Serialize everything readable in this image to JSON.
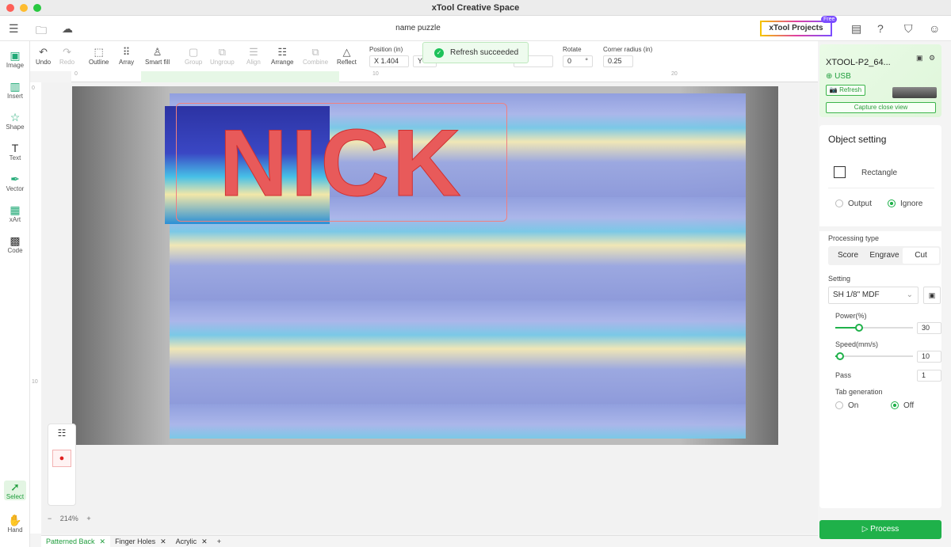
{
  "app_title": "xTool Creative Space",
  "document_name": "name puzzle",
  "header": {
    "projects_label": "xTool Projects",
    "free_badge": "Free"
  },
  "left_tools": [
    {
      "label": "Image"
    },
    {
      "label": "Insert"
    },
    {
      "label": "Shape"
    },
    {
      "label": "Text"
    },
    {
      "label": "Vector"
    },
    {
      "label": "xArt"
    },
    {
      "label": "Code"
    },
    {
      "label": "Select"
    },
    {
      "label": "Hand"
    }
  ],
  "toolbar": {
    "undo": "Undo",
    "redo": "Redo",
    "outline": "Outline",
    "array": "Array",
    "smart_fill": "Smart fill",
    "group": "Group",
    "ungroup": "Ungroup",
    "align": "Align",
    "arrange": "Arrange",
    "combine": "Combine",
    "reflect": "Reflect",
    "position_label": "Position (in)",
    "x_value": "X 1.404",
    "y_value": "Y",
    "rotate_label": "Rotate",
    "rotate_value": "0",
    "rotate_unit": "°",
    "corner_label": "Corner radius (in)",
    "corner_value": "0.25"
  },
  "toast": "Refresh succeeded",
  "ruler": {
    "h_ticks": [
      "0",
      "10",
      "20"
    ],
    "v_ticks": [
      "0",
      "10"
    ]
  },
  "canvas": {
    "text": "NICK"
  },
  "zoom": {
    "value": "214%",
    "minus": "−",
    "plus": "+"
  },
  "tabs": [
    {
      "label": "Patterned Back",
      "active": true
    },
    {
      "label": "Finger Holes"
    },
    {
      "label": "Acrylic"
    }
  ],
  "device": {
    "name": "XTOOL-P2_64...",
    "connection": "USB",
    "refresh": "Refresh",
    "capture": "Capture close view"
  },
  "object_setting": {
    "title": "Object setting",
    "shape": "Rectangle",
    "output": "Output",
    "ignore": "Ignore",
    "selected": "Ignore"
  },
  "processing": {
    "title": "Processing type",
    "types": [
      "Score",
      "Engrave",
      "Cut"
    ],
    "selected": "Cut",
    "setting_label": "Setting",
    "material": "SH 1/8\" MDF",
    "power_label": "Power(%)",
    "power": "30",
    "speed_label": "Speed(mm/s)",
    "speed": "10",
    "pass_label": "Pass",
    "pass": "1",
    "tab_label": "Tab generation",
    "on": "On",
    "off": "Off",
    "tab_selected": "Off"
  },
  "process_button": "Process",
  "colors": {
    "accent": "#1fb14a",
    "cut_line": "#f06060"
  }
}
